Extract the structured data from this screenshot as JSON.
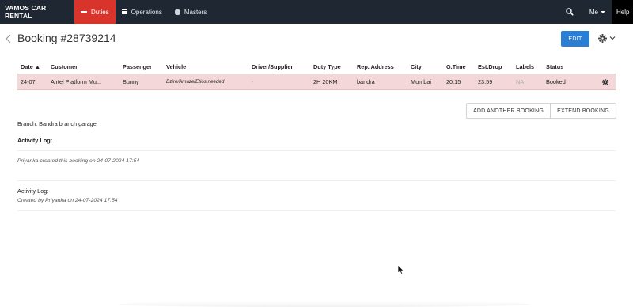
{
  "navbar": {
    "brand": "VAMOS CAR RENTAL",
    "items": [
      {
        "label": "Duties",
        "icon": "minus-icon",
        "active": true
      },
      {
        "label": "Operations",
        "icon": "list-icon",
        "active": false
      },
      {
        "label": "Masters",
        "icon": "database-icon",
        "active": false
      }
    ],
    "me_label": "Me",
    "help_label": "Help",
    "colors": {
      "bar": "#1f2733",
      "active": "#d9342b"
    }
  },
  "header": {
    "title": "Booking #28739214",
    "edit_label": "EDIT"
  },
  "table": {
    "columns": [
      "Date ▲",
      "Customer",
      "Passenger",
      "Vehicle",
      "Driver/Supplier",
      "Duty Type",
      "Rep. Address",
      "City",
      "G.Time",
      "Est.Drop",
      "Labels",
      "Status"
    ],
    "rows": [
      {
        "date": "24-07",
        "customer": "Airtel Platform Mu...",
        "passenger": "Bunny",
        "vehicle": "Dzire/Amaze/Etios needed",
        "driver": "-",
        "duty_type": "2H 20KM",
        "rep_address": "bandra",
        "city": "Mumbai",
        "g_time": "20:15",
        "est_drop": "23:59",
        "labels": "NA",
        "status": "Booked"
      }
    ],
    "row_color": "#f4d7d8"
  },
  "actions": {
    "add_another": "ADD ANOTHER BOOKING",
    "extend": "EXTEND BOOKING"
  },
  "branch": "Branch: Bandra branch garage",
  "activity": [
    {
      "title": "Activity Log:",
      "entry": "Priyanka created this booking on 24-07-2024 17:54"
    },
    {
      "title": "Activity Log:",
      "entry": "Created by Priyanka on 24-07-2024 17:54"
    }
  ],
  "accent": "#2a7fd4"
}
